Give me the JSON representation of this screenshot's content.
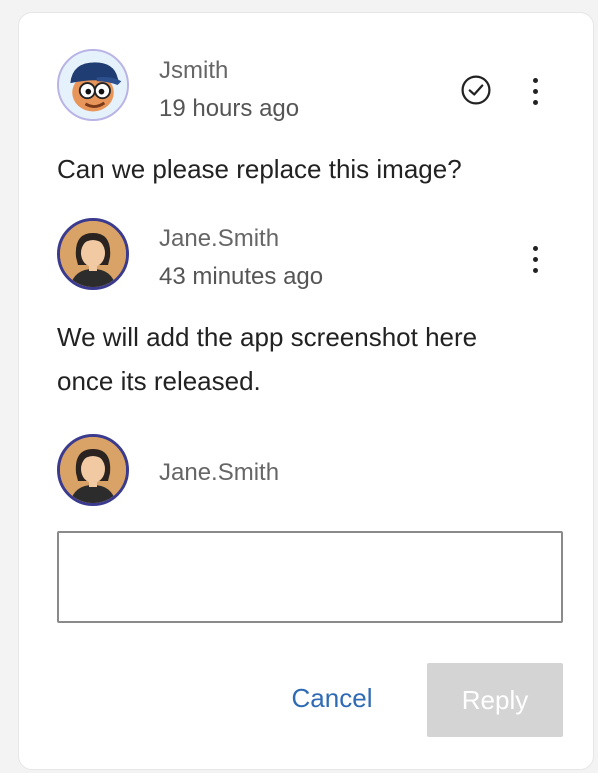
{
  "thread": {
    "comment": {
      "author": "Jsmith",
      "time": "19 hours ago",
      "text": "Can we please replace this image?",
      "resolve_icon": "check-circle-icon",
      "more_icon": "more-vertical-icon"
    },
    "reply": {
      "author": "Jane.Smith",
      "time": "43 minutes ago",
      "text": "We will add the app screenshot here once its released.",
      "more_icon": "more-vertical-icon"
    },
    "composer": {
      "author": "Jane.Smith",
      "input_value": "",
      "cancel_label": "Cancel",
      "reply_label": "Reply"
    }
  },
  "colors": {
    "link": "#2f6bb5",
    "disabled_button": "#d4d4d4",
    "avatar_ring": "#3a3b8e"
  }
}
